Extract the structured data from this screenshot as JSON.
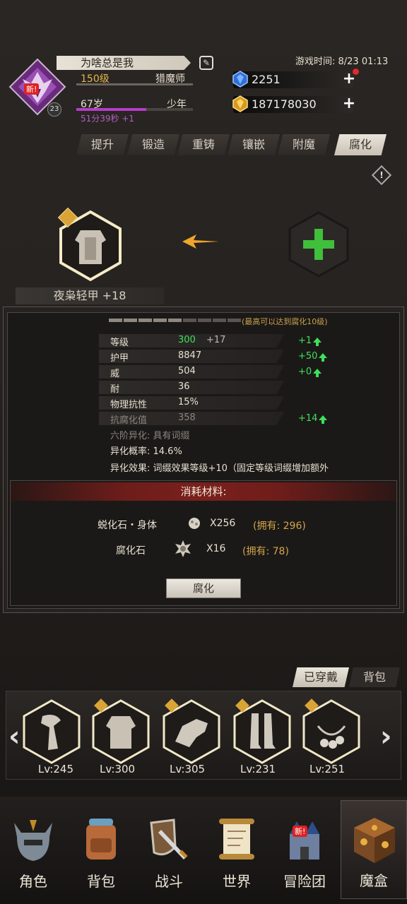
{
  "profile": {
    "name": "为啥总是我",
    "level": "150级",
    "class": "猎魔师",
    "age": "67岁",
    "age_stage": "少年",
    "timer": "51分39秒 +1",
    "avatar_badge": "新!",
    "avatar_level": "23"
  },
  "game_time": "游戏时间: 8/23 01:13",
  "resources": {
    "diamond": "2251",
    "gold": "187178030",
    "plus": "+"
  },
  "tabs": [
    "提升",
    "锻造",
    "重铸",
    "镶嵌",
    "附魔",
    "腐化"
  ],
  "active_tab": "腐化",
  "warning_icon": "!",
  "item": {
    "name": "夜枭轻甲 +18",
    "arrow": "←",
    "add": "+"
  },
  "corruption": {
    "max_note": "(最高可以达到腐化10级)",
    "pips_filled": 5,
    "pips_total": 10,
    "stats": [
      {
        "key": "等级",
        "value": "300",
        "bonus": "+17",
        "delta": "+1"
      },
      {
        "key": "护甲",
        "value": "8847",
        "bonus": "",
        "delta": "+50"
      },
      {
        "key": "威",
        "value": "504",
        "bonus": "",
        "delta": "+0"
      },
      {
        "key": "耐",
        "value": "36",
        "bonus": "",
        "delta": ""
      },
      {
        "key": "物理抗性",
        "value": "15%",
        "bonus": "",
        "delta": ""
      },
      {
        "key": "抗腐化值",
        "value": "358",
        "bonus": "",
        "delta": "+14"
      }
    ],
    "lines": [
      "六阶异化:  具有词缀",
      "异化概率:  14.6%",
      "异化效果:  词缀效果等级+10（固定等级词缀增加额外"
    ]
  },
  "materials": {
    "title": "消耗材料:",
    "items": [
      {
        "name": "蜕化石・身体",
        "count": "X256",
        "owned": "(拥有: 296)"
      },
      {
        "name": "腐化石",
        "count": "X16",
        "owned": "(拥有: 78)"
      }
    ],
    "button": "腐化"
  },
  "bag_tabs": {
    "equipped": "已穿戴",
    "bag": "背包"
  },
  "equipment": [
    "Lv:245",
    "Lv:300",
    "Lv:305",
    "Lv:231",
    "Lv:251"
  ],
  "carousel": {
    "left": "‹",
    "right": "›"
  },
  "nav": [
    {
      "label": "角色",
      "icon": "helmet-icon"
    },
    {
      "label": "背包",
      "icon": "backpack-icon"
    },
    {
      "label": "战斗",
      "icon": "sword-shield-icon"
    },
    {
      "label": "世界",
      "icon": "scroll-map-icon"
    },
    {
      "label": "冒险团",
      "icon": "castle-icon",
      "badge": "新!"
    },
    {
      "label": "魔盒",
      "icon": "magic-cube-icon"
    }
  ],
  "colors": {
    "accent_gold": "#e2b94a",
    "green_up": "#3ee05a",
    "material_header": "#7a201c",
    "timer_purple": "#b060c0"
  }
}
